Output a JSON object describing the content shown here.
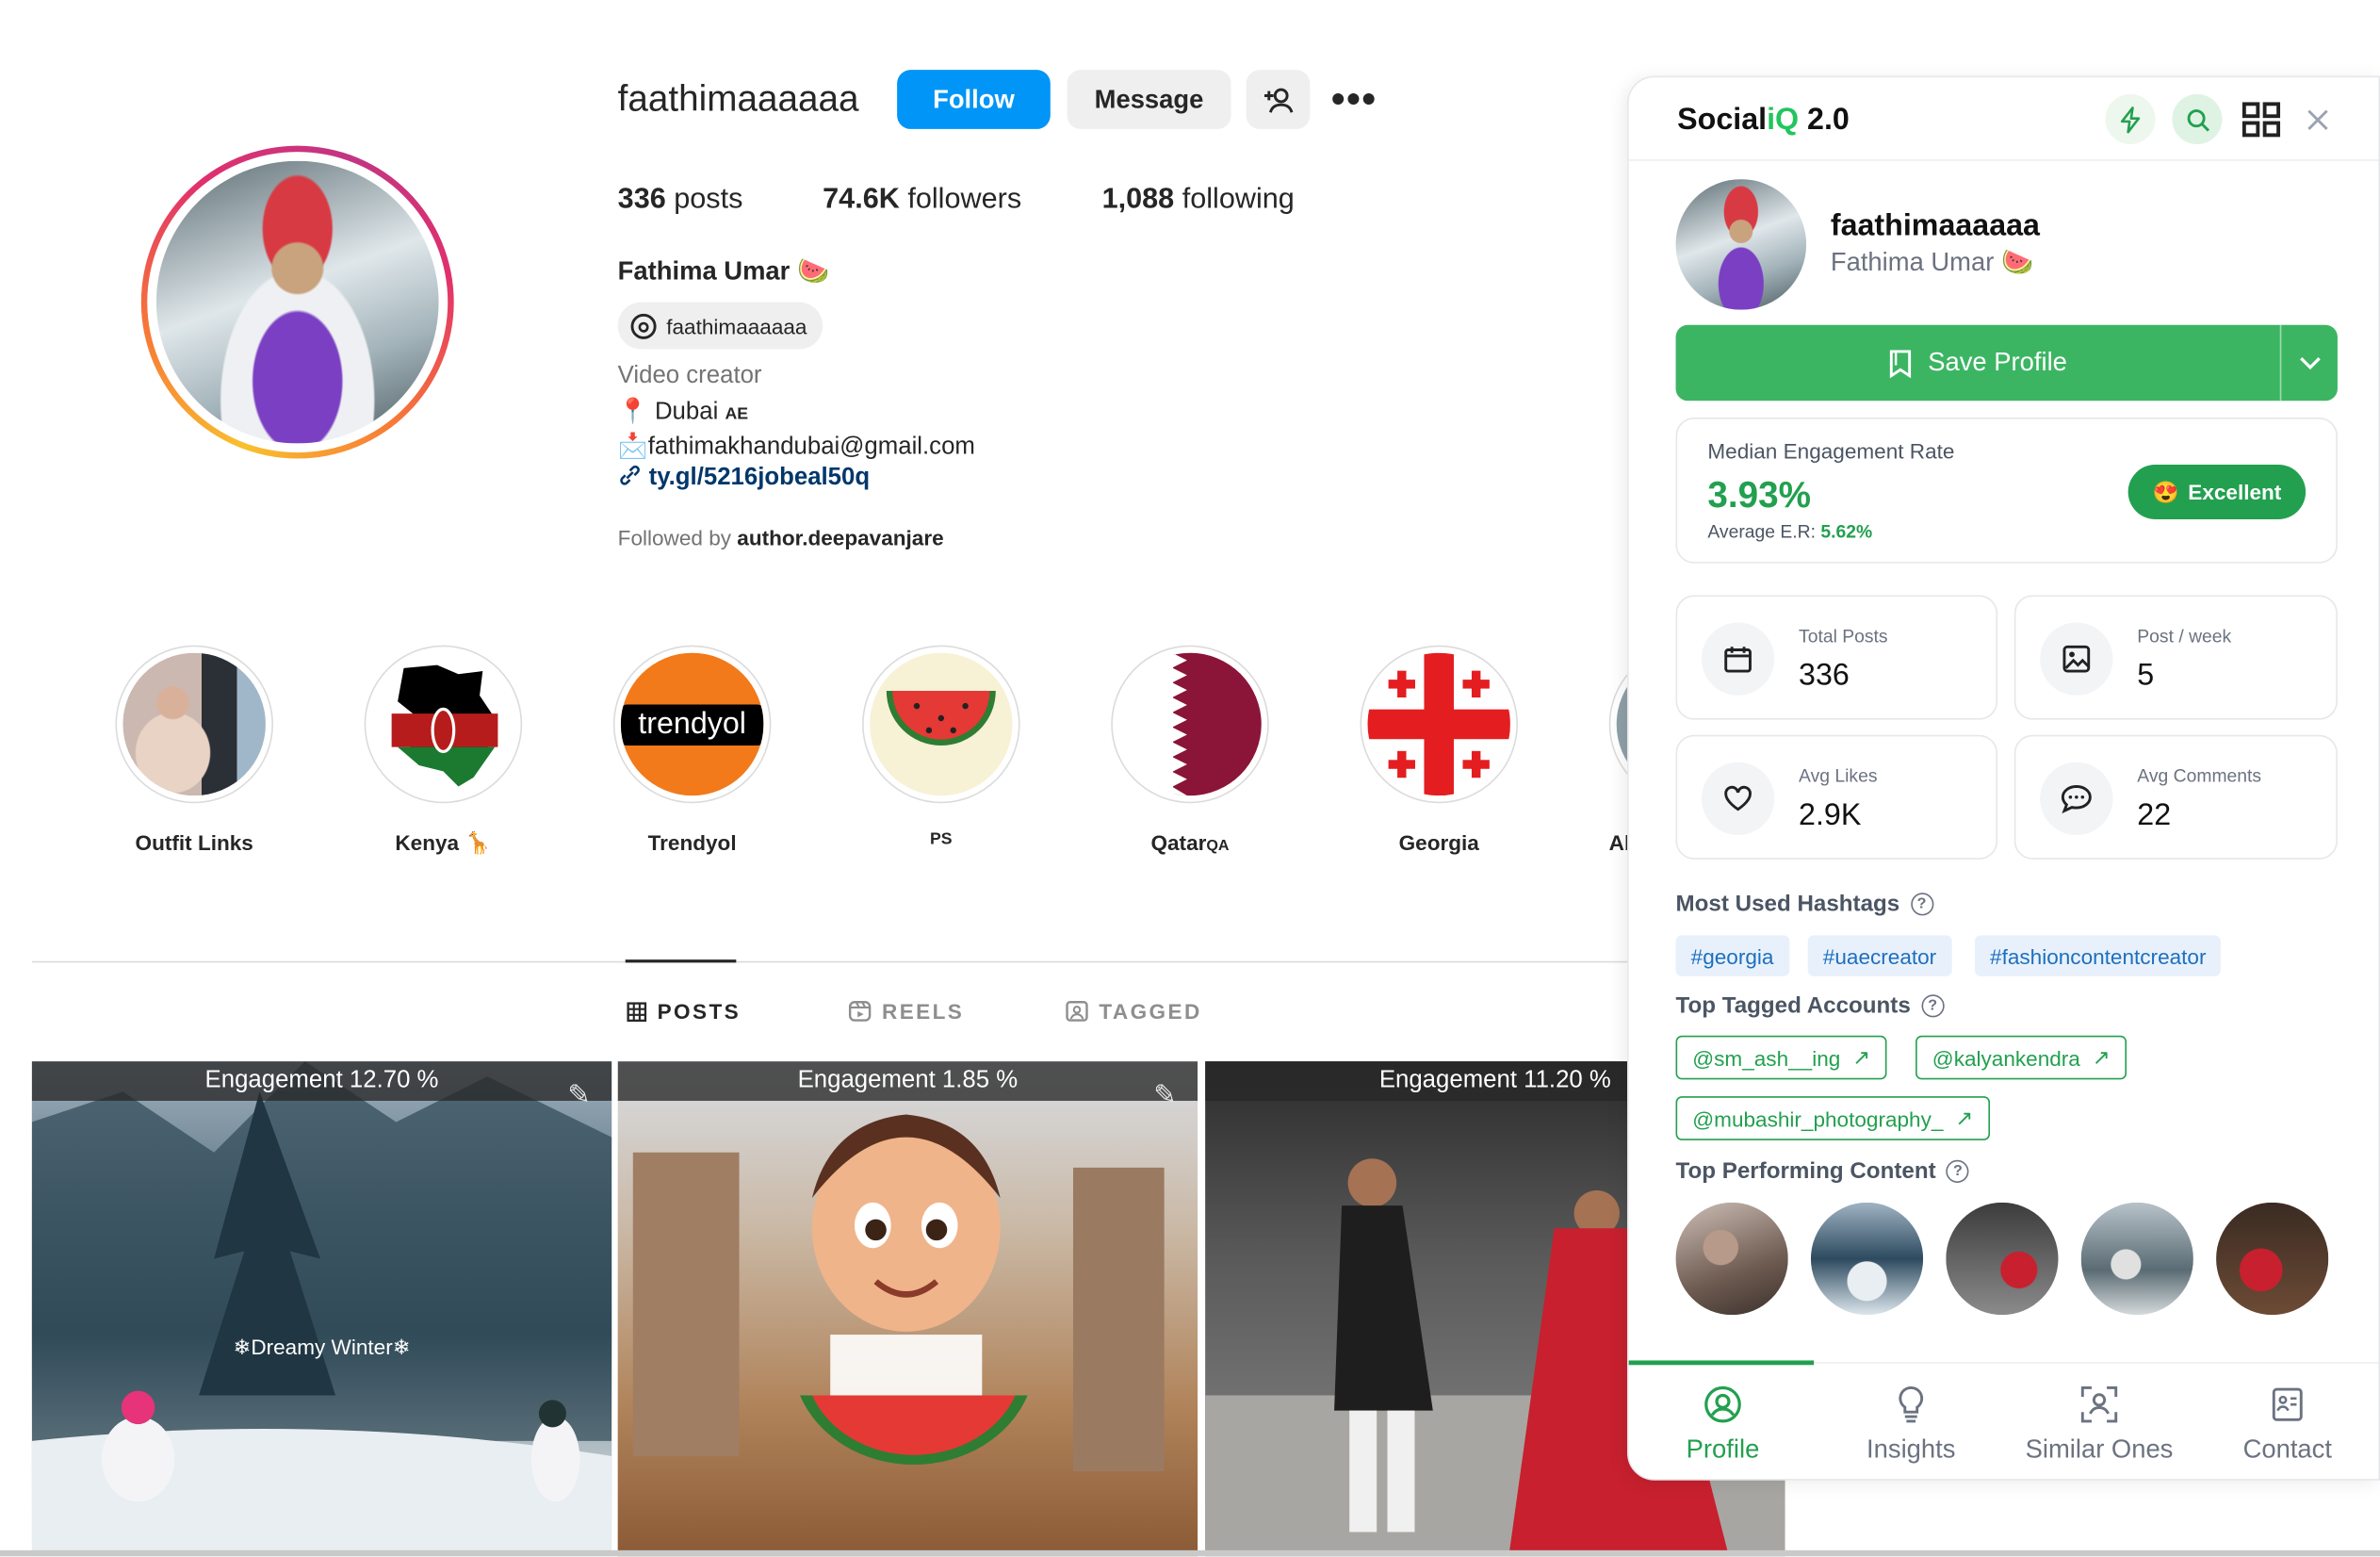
{
  "profile": {
    "username": "faathimaaaaaa",
    "follow_label": "Follow",
    "message_label": "Message",
    "posts_count": "336",
    "posts_label": "posts",
    "followers_count": "74.6K",
    "followers_label": "followers",
    "following_count": "1,088",
    "following_label": "following",
    "full_name": "Fathima Umar",
    "name_emoji": "🍉",
    "threads_handle": "faathimaaaaaa",
    "category": "Video creator",
    "location_emoji": "📍",
    "location": "Dubai",
    "location_flag": "AE",
    "mail_emoji": "📩",
    "email": "fathimakhandubai@gmail.com",
    "link": "ty.gl/5216jobeal50q",
    "followed_by_prefix": "Followed by",
    "followed_by_user": "author.deepavanjare"
  },
  "highlights": [
    {
      "label": "Outfit Links"
    },
    {
      "label": "Kenya",
      "suffix": "🦒"
    },
    {
      "label": "Trendyol",
      "badge": "trendyol"
    },
    {
      "label": "PS"
    },
    {
      "label": "Qatar",
      "suffix": "QA"
    },
    {
      "label": "Georgia"
    },
    {
      "label": "Ab"
    }
  ],
  "tabs": {
    "posts": "POSTS",
    "reels": "REELS",
    "tagged": "TAGGED"
  },
  "posts": [
    {
      "engagement": "Engagement 12.70 %",
      "overlay_text": "❄Dreamy Winter❄"
    },
    {
      "engagement": "Engagement 1.85 %"
    },
    {
      "engagement": "Engagement 11.20 %"
    }
  ],
  "panel": {
    "logo_prefix": "Social",
    "logo_iq": "iQ",
    "logo_version": " 2.0",
    "username": "faathimaaaaaa",
    "full_name": "Fathima Umar",
    "name_emoji": "🍉",
    "save_label": "Save Profile",
    "er_title": "Median Engagement Rate",
    "er_value": "3.93%",
    "er_avg_label": "Average E.R:",
    "er_avg_value": "5.62%",
    "er_badge": "Excellent",
    "er_badge_emoji": "😍",
    "stats": {
      "total_posts_label": "Total Posts",
      "total_posts_value": "336",
      "post_week_label": "Post / week",
      "post_week_value": "5",
      "avg_likes_label": "Avg Likes",
      "avg_likes_value": "2.9K",
      "avg_comments_label": "Avg Comments",
      "avg_comments_value": "22"
    },
    "hashtags_title": "Most Used Hashtags",
    "hashtags": [
      "#georgia",
      "#uaecreator",
      "#fashioncontentcreator"
    ],
    "tagged_title": "Top Tagged Accounts",
    "tagged_accounts": [
      "@sm_ash__ing",
      "@kalyankendra",
      "@mubashir_photography_"
    ],
    "top_content_title": "Top Performing Content",
    "nav": {
      "profile": "Profile",
      "insights": "Insights",
      "similar": "Similar Ones",
      "contact": "Contact"
    },
    "accent_color": "#22a04f"
  }
}
